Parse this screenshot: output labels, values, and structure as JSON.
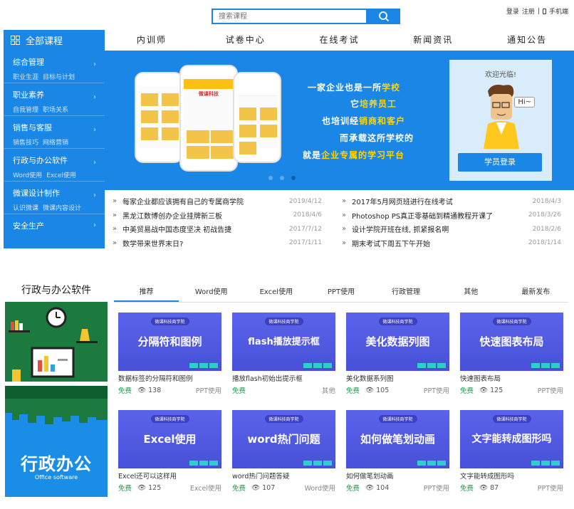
{
  "search": {
    "placeholder": "搜索课程"
  },
  "top_links": {
    "login": "登录",
    "register": "注册",
    "sep": "|",
    "mobile": "手机端"
  },
  "all_courses": "全部课程",
  "nav": [
    "内训师",
    "试卷中心",
    "在线考试",
    "新闻资讯",
    "通知公告"
  ],
  "sidebar": [
    {
      "title": "综合管理",
      "subs": [
        "职业生涯",
        "目标与计划"
      ]
    },
    {
      "title": "职业素养",
      "subs": [
        "自我管理",
        "职场关系"
      ]
    },
    {
      "title": "销售与客服",
      "subs": [
        "销售技巧",
        "网络营销"
      ]
    },
    {
      "title": "行政与办公软件",
      "subs": [
        "Word使用",
        "Excel使用"
      ]
    },
    {
      "title": "微课设计制作",
      "subs": [
        "认识微课",
        "微课内容设计"
      ]
    },
    {
      "title": "安全生产",
      "subs": []
    }
  ],
  "banner": {
    "slogans": [
      [
        "一家企业也是一所",
        "学校"
      ],
      [
        "它",
        "培养员工"
      ],
      [
        "也培训经",
        "销商和客户"
      ],
      [
        "而承载这所学校的",
        ""
      ],
      [
        "就是",
        "企业专属的学习平台"
      ]
    ],
    "phone_title": "微课科技"
  },
  "welcome": {
    "greeting": "欢迎光临!",
    "bubble": "Hi~",
    "login_button": "学员登录"
  },
  "news_left": [
    {
      "title": "每家企业都应该拥有自己的专属商学院",
      "date": "2019/4/12"
    },
    {
      "title": "黑龙江数博创办企业挂牌新三板",
      "date": "2018/4/6"
    },
    {
      "title": "中美贸易战中国态度坚决 初战告捷",
      "date": "2017/7/12"
    },
    {
      "title": "数学带来世界末日?",
      "date": "2017/1/11"
    }
  ],
  "news_right": [
    {
      "title": "2017年5月网页班进行在线考试",
      "date": "2018/4/3"
    },
    {
      "title": "Photoshop PS真正零基础到精通教程开课了",
      "date": "2018/3/26"
    },
    {
      "title": "设计学院开班在线, 抓紧报名啊",
      "date": "2018/2/6"
    },
    {
      "title": "期末考试下周五下午开始",
      "date": "2018/1/14"
    }
  ],
  "section": {
    "title": "行政与办公软件",
    "tabs": [
      "推荐",
      "Word使用",
      "Excel使用",
      "PPT使用",
      "行政管理",
      "其他",
      "最新发布"
    ],
    "left_banner_title": "行政办公",
    "left_banner_sub": "Office software"
  },
  "cards": [
    {
      "banner": "分隔符和图例",
      "name": "数据标签的分隔符和图例",
      "free": "免费",
      "views": "138",
      "type": "PPT使用"
    },
    {
      "banner": "flash播放提示框",
      "name": "播放flash初始出提示框",
      "free": "免费",
      "views": "",
      "type": "其他"
    },
    {
      "banner": "美化数据列图",
      "name": "美化数据系列图",
      "free": "免费",
      "views": "105",
      "type": "PPT使用"
    },
    {
      "banner": "快速图表布局",
      "name": "快速图表布局",
      "free": "免费",
      "views": "125",
      "type": "PPT使用"
    },
    {
      "banner": "Excel使用",
      "name": "Excel还可以这样用",
      "free": "免费",
      "views": "125",
      "type": "Excel使用"
    },
    {
      "banner": "word热门问题",
      "name": "word热门问题答疑",
      "free": "免费",
      "views": "107",
      "type": "Word使用"
    },
    {
      "banner": "如何做笔划动画",
      "name": "如何做笔划动画",
      "free": "免费",
      "views": "104",
      "type": "PPT使用"
    },
    {
      "banner": "文字能转成图形吗",
      "name": "文字能转成图形吗",
      "free": "免费",
      "views": "87",
      "type": "PPT使用"
    }
  ],
  "card_logo": "微课科技商学院",
  "colors": {
    "primary": "#1a87e6",
    "free": "#1ea04a",
    "accent": "#ffd400"
  }
}
